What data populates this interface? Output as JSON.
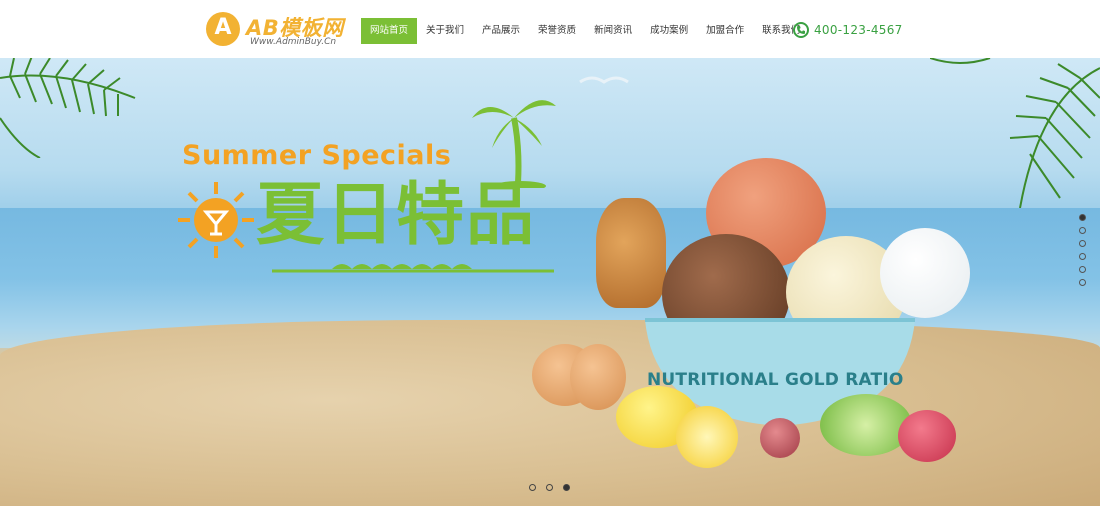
{
  "logo": {
    "badge_letter": "A",
    "title": "AB模板网",
    "subtitle": "Www.AdminBuy.Cn",
    "color": "#f2b233"
  },
  "nav": {
    "items": [
      {
        "label": "网站首页",
        "active": true
      },
      {
        "label": "关于我们",
        "active": false
      },
      {
        "label": "产品展示",
        "active": false
      },
      {
        "label": "荣誉资质",
        "active": false
      },
      {
        "label": "新闻资讯",
        "active": false
      },
      {
        "label": "成功案例",
        "active": false
      },
      {
        "label": "加盟合作",
        "active": false
      },
      {
        "label": "联系我们",
        "active": false
      }
    ],
    "active_color": "#7bbf35"
  },
  "phone": {
    "icon": "phone-icon",
    "number": "400-123-4567",
    "color": "#3aa142"
  },
  "banner": {
    "headline_en": "Summer Specials",
    "headline_cn": "夏日特品",
    "tagline": "NUTRITIONAL GOLD RATIO",
    "slide_indicators": {
      "count": 3,
      "active_index": 2
    },
    "side_indicators": {
      "count": 6,
      "active_index": 0
    }
  }
}
